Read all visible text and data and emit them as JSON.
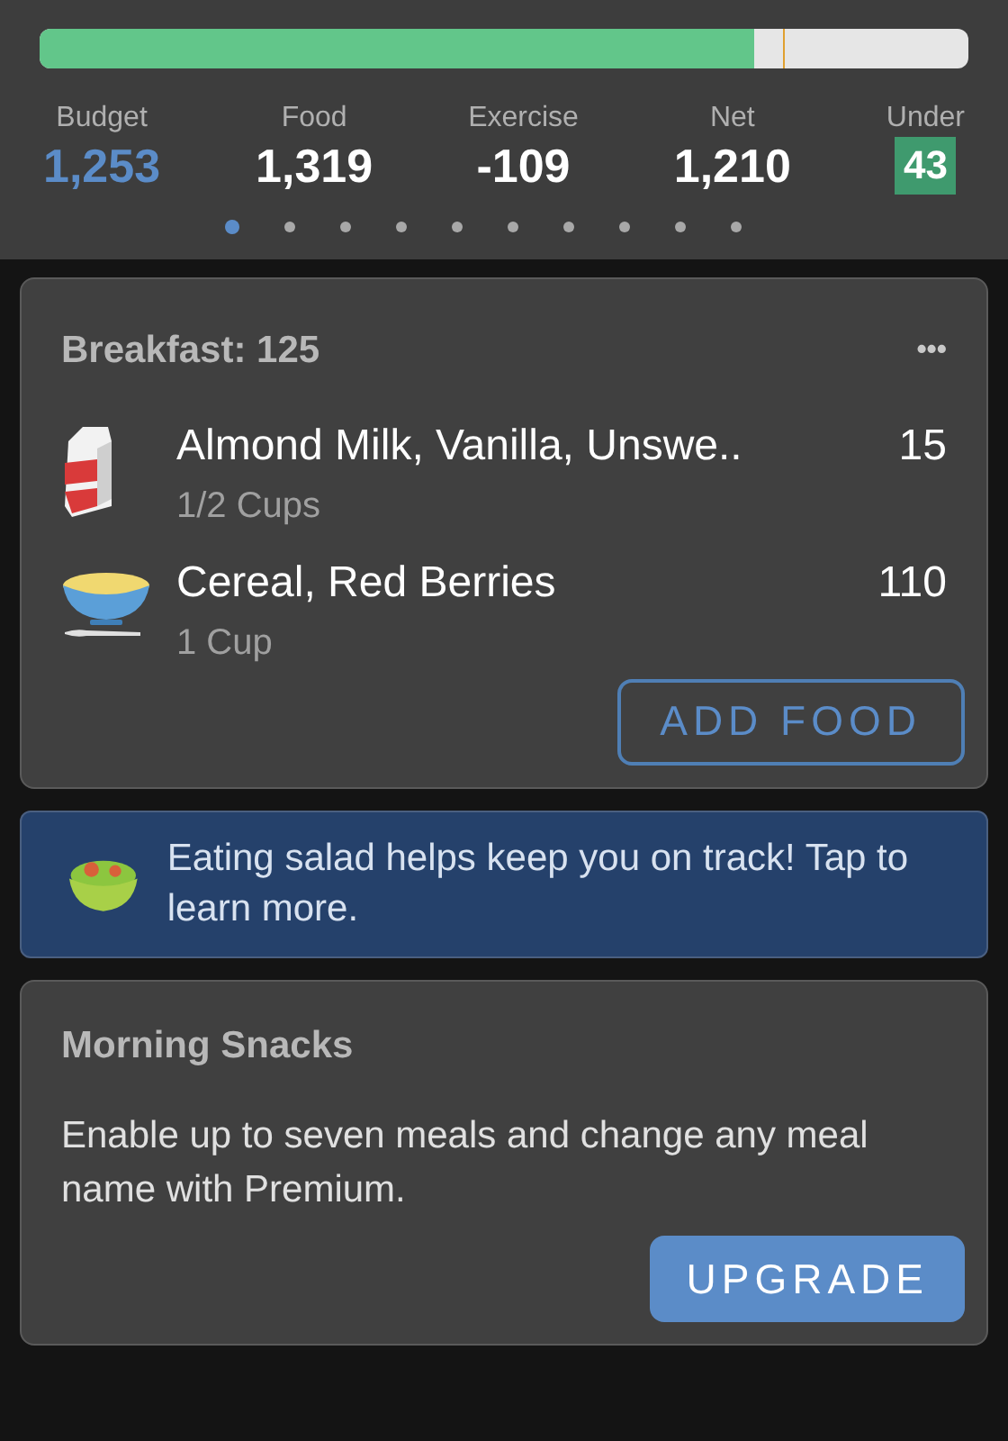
{
  "summary": {
    "level": 0.77,
    "stats": [
      {
        "label": "Budget",
        "value": "1,253",
        "kind": "budget"
      },
      {
        "label": "Food",
        "value": "1,319",
        "kind": "plain"
      },
      {
        "label": "Exercise",
        "value": "-109",
        "kind": "plain"
      },
      {
        "label": "Net",
        "value": "1,210",
        "kind": "plain"
      },
      {
        "label": "Under",
        "value": "43",
        "kind": "badge"
      }
    ],
    "pages": [
      {
        "selected": true
      },
      {
        "selected": false
      },
      {
        "selected": false
      },
      {
        "selected": false
      },
      {
        "selected": false
      },
      {
        "selected": false
      },
      {
        "selected": false
      },
      {
        "selected": false
      },
      {
        "selected": false
      },
      {
        "selected": false
      }
    ]
  },
  "breakfast": {
    "title": "Breakfast: 125",
    "menu": "•••",
    "items": [
      {
        "name": "Almond Milk, Vanilla, Unswe..",
        "amount": "1/2 Cups",
        "calories": "15",
        "kind": "milk"
      },
      {
        "name": "Cereal, Red Berries",
        "amount": "1 Cup",
        "calories": "110",
        "kind": "cereal"
      }
    ],
    "button": "ADD FOOD"
  },
  "tip": {
    "text": "Eating salad helps keep you on track! Tap to learn more."
  },
  "snacks": {
    "title": "Morning Snacks",
    "text": "Enable up to seven meals and change any meal name with Premium.",
    "button": "UPGRADE"
  }
}
